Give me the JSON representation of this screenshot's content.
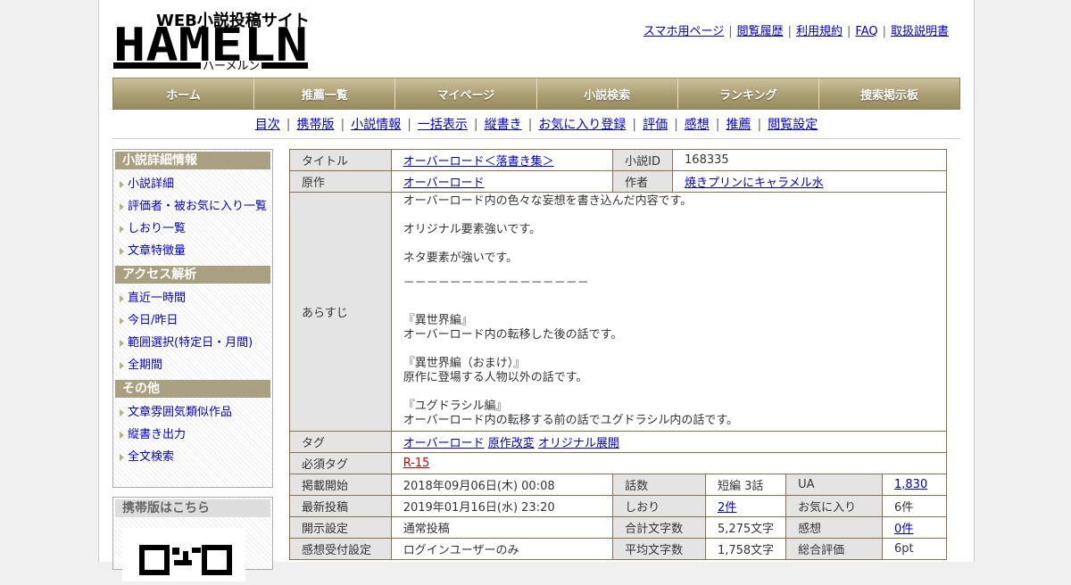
{
  "header": {
    "logo": {
      "tagline": "WEB小説投稿サイト",
      "wordmark": "HAMELN",
      "kana": "ハーメルン"
    },
    "top_links": [
      "スマホ用ページ",
      "閲覧履歴",
      "利用規約",
      "FAQ",
      "取扱説明書"
    ]
  },
  "main_nav": [
    "ホーム",
    "推薦一覧",
    "マイページ",
    "小説検索",
    "ランキング",
    "捜索掲示板"
  ],
  "sub_nav": [
    "目次",
    "携帯版",
    "小説情報",
    "一括表示",
    "縦書き",
    "お気に入り登録",
    "評価",
    "感想",
    "推薦",
    "閲覧設定"
  ],
  "sidebar": {
    "sections": [
      {
        "title": "小説詳細情報",
        "items": [
          "小説詳細",
          "評価者・被お気に入り一覧",
          "しおり一覧",
          "文章特徴量"
        ]
      },
      {
        "title": "アクセス解析",
        "items": [
          "直近一時間",
          "今日/昨日",
          "範囲選択(特定日・月間)",
          "全期間"
        ]
      },
      {
        "title": "その他",
        "items": [
          "文章雰囲気類似作品",
          "縦書き出力",
          "全文検索"
        ]
      }
    ],
    "mobile_title": "携帯版はこちら"
  },
  "info": {
    "title_label": "タイトル",
    "title": "オーバーロード＜落書き集＞",
    "id_label": "小説ID",
    "id": "168335",
    "original_label": "原作",
    "original": "オーバーロード",
    "author_label": "作者",
    "author": "焼きプリンにキャラメル水",
    "synopsis_label": "あらすじ",
    "synopsis": [
      "オーバーロード内の色々な妄想を書き込んだ内容です。",
      "オリジナル要素強いです。",
      "ネタ要素が強いです。",
      "－－－－－－－－－－－－－－－－",
      "『異世界編』\nオーバーロード内の転移した後の話です。",
      "『異世界編（おまけ）』\n原作に登場する人物以外の話です。",
      "『ユグドラシル編』\nオーバーロード内の転移する前の話でユグドラシル内の話です。"
    ],
    "tags_label": "タグ",
    "tags": [
      "オーバーロード",
      "原作改変",
      "オリジナル展開"
    ],
    "required_tags_label": "必須タグ",
    "required_tag": "R-15",
    "rows": [
      {
        "label1": "掲載開始",
        "value1": "2018年09月06日(木) 00:08",
        "label2": "話数",
        "value2": "短編 3話",
        "label3": "UA",
        "value3": "1,830"
      },
      {
        "label1": "最新投稿",
        "value1": "2019年01月16日(水) 23:20",
        "label2": "しおり",
        "value2": "2件",
        "label3": "お気に入り",
        "value3": "6件"
      },
      {
        "label1": "開示設定",
        "value1": "通常投稿",
        "label2": "合計文字数",
        "value2": "5,275文字",
        "label3": "感想",
        "value3": "0件"
      },
      {
        "label1": "感想受付設定",
        "value1": "ログインユーザーのみ",
        "label2": "平均文字数",
        "value2": "1,758文字",
        "label3": "総合評価",
        "value3": "6pt"
      }
    ]
  }
}
